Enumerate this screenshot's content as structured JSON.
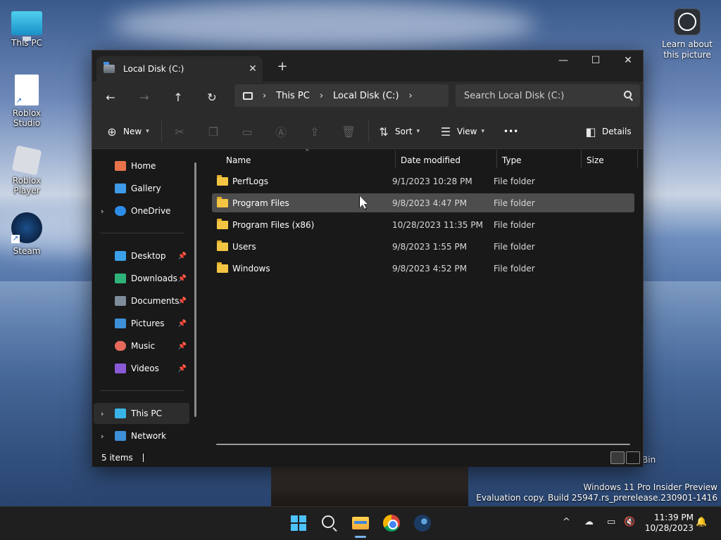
{
  "desktop": {
    "icons": [
      {
        "label": "This PC"
      },
      {
        "label": "Roblox Studio"
      },
      {
        "label": "Roblox Player"
      },
      {
        "label": "Steam"
      }
    ],
    "learn_label": "Learn about this picture",
    "recycle_bin_partial": "Bin",
    "watermark": {
      "line1": "Windows 11 Pro Insider Preview",
      "line2": "Evaluation copy. Build 25947.rs_prerelease.230901-1416"
    }
  },
  "window": {
    "tab_title": "Local Disk (C:)",
    "tab_close": "✕",
    "new_tab": "+",
    "controls": {
      "minimize": "—",
      "maximize": "☐",
      "close": "✕"
    },
    "nav": {
      "back": "←",
      "forward": "→",
      "up": "↑",
      "refresh": "↻"
    },
    "breadcrumb": [
      "This PC",
      "Local Disk (C:)"
    ],
    "search_placeholder": "Search Local Disk (C:)",
    "toolbar": {
      "new_label": "New",
      "sort_label": "Sort",
      "view_label": "View",
      "more_label": "•••",
      "details_label": "Details"
    },
    "nav_pane": {
      "quick": [
        {
          "label": "Home",
          "color": "#e8734a"
        },
        {
          "label": "Gallery",
          "color": "#3f9be8"
        },
        {
          "label": "OneDrive",
          "color": "#2d8ce8"
        }
      ],
      "pinned": [
        {
          "label": "Desktop",
          "color": "#3aa0e8"
        },
        {
          "label": "Downloads",
          "color": "#2fb37a"
        },
        {
          "label": "Documents",
          "color": "#7f8c9a"
        },
        {
          "label": "Pictures",
          "color": "#3d8fd8"
        },
        {
          "label": "Music",
          "color": "#e66a5c"
        },
        {
          "label": "Videos",
          "color": "#8a5ad6"
        }
      ],
      "devices": [
        {
          "label": "This PC",
          "color": "#3ab4e8"
        },
        {
          "label": "Network",
          "color": "#3d8fd8"
        }
      ]
    },
    "columns": [
      "Name",
      "Date modified",
      "Type",
      "Size"
    ],
    "rows": [
      {
        "name": "PerfLogs",
        "date": "9/1/2023 10:28 PM",
        "type": "File folder"
      },
      {
        "name": "Program Files",
        "date": "9/8/2023 4:47 PM",
        "type": "File folder"
      },
      {
        "name": "Program Files (x86)",
        "date": "10/28/2023 11:35 PM",
        "type": "File folder"
      },
      {
        "name": "Users",
        "date": "9/8/2023 1:55 PM",
        "type": "File folder"
      },
      {
        "name": "Windows",
        "date": "9/8/2023 4:52 PM",
        "type": "File folder"
      }
    ],
    "status": "5 items"
  },
  "taskbar": {
    "time": "11:39 PM",
    "date": "10/28/2023",
    "tray_chevron": "^"
  }
}
